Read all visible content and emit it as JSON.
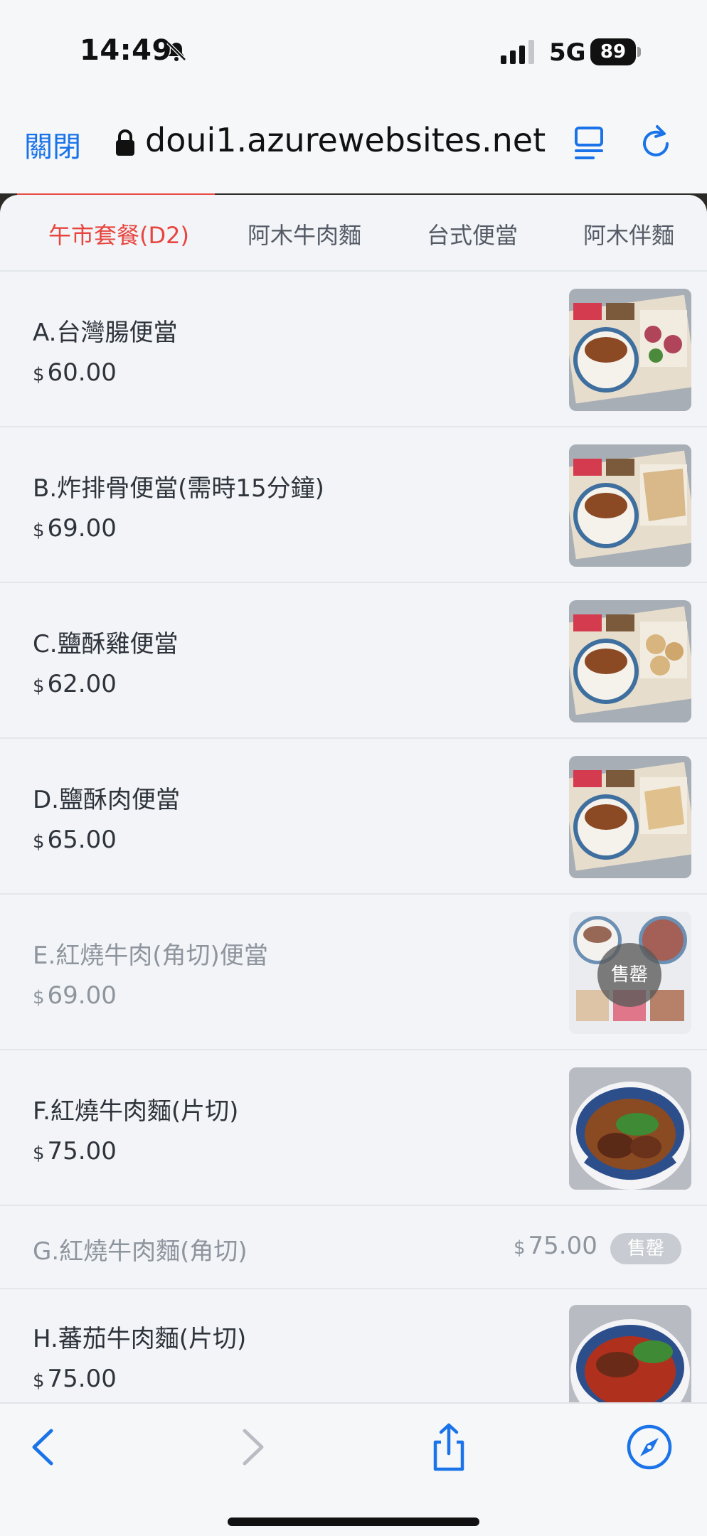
{
  "status_bar": {
    "time": "14:49",
    "network": "5G",
    "battery": "89",
    "icons": [
      "bell-slash-icon",
      "signal-icon",
      "battery-icon"
    ]
  },
  "browser": {
    "close_label": "關閉",
    "url": "doui1.azurewebsites.net",
    "icons": [
      "lock-icon",
      "reader-icon",
      "reload-icon"
    ]
  },
  "tabs": [
    {
      "label": "午市套餐(D2)",
      "active": true
    },
    {
      "label": "阿木牛肉麵",
      "active": false
    },
    {
      "label": "台式便當",
      "active": false
    },
    {
      "label": "阿木伴麵",
      "active": false
    }
  ],
  "currency": "$",
  "items": [
    {
      "name": "A.台灣腸便當",
      "price": "60.00",
      "sold_out": false
    },
    {
      "name": "B.炸排骨便當(需時15分鐘)",
      "price": "69.00",
      "sold_out": false
    },
    {
      "name": "C.鹽酥雞便當",
      "price": "62.00",
      "sold_out": false
    },
    {
      "name": "D.鹽酥肉便當",
      "price": "65.00",
      "sold_out": false
    },
    {
      "name": "E.紅燒牛肉(角切)便當",
      "price": "69.00",
      "sold_out": true,
      "sold_out_label": "售罄"
    },
    {
      "name": "F.紅燒牛肉麵(片切)",
      "price": "75.00",
      "sold_out": false
    },
    {
      "name": "G.紅燒牛肉麵(角切)",
      "price": "75.00",
      "sold_out": true,
      "sold_out_label": "售罄"
    },
    {
      "name": "H.蕃茄牛肉麵(片切)",
      "price": "75.00",
      "sold_out": false
    }
  ],
  "toolbar": {
    "icons": [
      "back-icon",
      "forward-icon",
      "share-icon",
      "compass-icon"
    ]
  },
  "colors": {
    "accent": "#e8453f",
    "link": "#1a73e8",
    "background": "#f2f4f7"
  }
}
